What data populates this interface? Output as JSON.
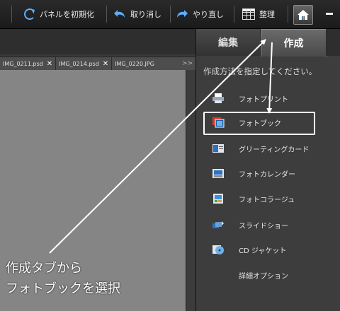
{
  "toolbar": {
    "reset_panels": "パネルを初期化",
    "undo": "取り消し",
    "redo": "やり直し",
    "organize": "整理"
  },
  "document_tabs": [
    "IMG_0211.psd",
    "IMG_0214.psd",
    "IMG_0220.JPG"
  ],
  "overflow_glyph": ">>",
  "panel": {
    "tabs": [
      {
        "label": "編集"
      },
      {
        "label": "作成"
      }
    ],
    "active_tab": "作成",
    "instruction": "作成方法を指定してください。",
    "items": [
      {
        "label": "フォトプリント",
        "icon": "printer-icon"
      },
      {
        "label": "フォトブック",
        "icon": "photo-book-icon"
      },
      {
        "label": "グリーティングカード",
        "icon": "greeting-card-icon"
      },
      {
        "label": "フォトカレンダー",
        "icon": "calendar-icon"
      },
      {
        "label": "フォトコラージュ",
        "icon": "collage-icon"
      },
      {
        "label": "スライドショー",
        "icon": "slideshow-icon"
      },
      {
        "label": "CD ジャケット",
        "icon": "cd-icon"
      },
      {
        "label": "詳細オプション",
        "icon": ""
      }
    ],
    "highlighted_item": "フォトブック"
  },
  "annotation": {
    "line1": "作成タブから",
    "line2": "フォトブックを選択"
  },
  "colors": {
    "accent_blue": "#5ab0ff",
    "highlight": "#ffffff",
    "canvas": "#858585"
  }
}
